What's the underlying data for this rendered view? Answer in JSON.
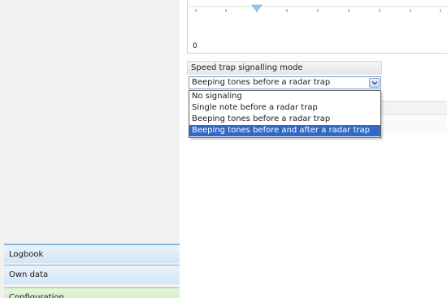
{
  "chart": {
    "zero_label": "0"
  },
  "speed_trap": {
    "group_title": "Speed trap signalling mode",
    "selected_value": "Beeping tones before a radar trap",
    "options": [
      "No signaling",
      "Single note before a radar trap",
      "Beeping tones before a radar trap",
      "Beeping tones before and after a radar trap"
    ],
    "highlighted_index": 3
  },
  "nav": {
    "items": [
      "Logbook",
      "Own data",
      "Configuration"
    ]
  },
  "colors": {
    "selection": "#3169c6",
    "nav_blue": "#d4e6f6",
    "nav_green": "#c6e8b7",
    "slider_marker": "#8ec6ea"
  },
  "icons": {
    "combo_arrow": "chevron-down-icon",
    "slider_marker": "triangle-marker-icon"
  }
}
